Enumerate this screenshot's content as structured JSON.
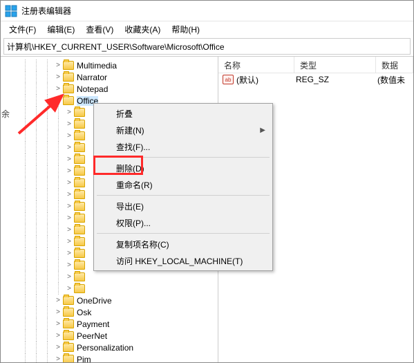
{
  "window": {
    "title": "注册表编辑器"
  },
  "menu": {
    "file": "文件(F)",
    "edit": "编辑(E)",
    "view": "查看(V)",
    "favorites": "收藏夹(A)",
    "help": "帮助(H)"
  },
  "address": {
    "path": "计算机\\HKEY_CURRENT_USER\\Software\\Microsoft\\Office"
  },
  "list": {
    "headers": {
      "name": "名称",
      "type": "类型",
      "data": "数据"
    },
    "rows": [
      {
        "icon": "ab",
        "name": "(默认)",
        "type": "REG_SZ",
        "data": "(数值未"
      }
    ]
  },
  "tree": {
    "items": [
      {
        "indent": 88,
        "expander": ">",
        "label": "Multimedia"
      },
      {
        "indent": 88,
        "expander": ">",
        "label": "Narrator"
      },
      {
        "indent": 88,
        "expander": ">",
        "label": "Notepad"
      },
      {
        "indent": 88,
        "expander": "v",
        "label": "Office",
        "selected": true
      },
      {
        "indent": 104,
        "expander": ">",
        "label": ""
      },
      {
        "indent": 104,
        "expander": ">",
        "label": ""
      },
      {
        "indent": 104,
        "expander": ">",
        "label": ""
      },
      {
        "indent": 104,
        "expander": ">",
        "label": ""
      },
      {
        "indent": 104,
        "expander": ">",
        "label": ""
      },
      {
        "indent": 104,
        "expander": ">",
        "label": ""
      },
      {
        "indent": 104,
        "expander": ">",
        "label": ""
      },
      {
        "indent": 104,
        "expander": ">",
        "label": ""
      },
      {
        "indent": 104,
        "expander": ">",
        "label": ""
      },
      {
        "indent": 104,
        "expander": ">",
        "label": ""
      },
      {
        "indent": 104,
        "expander": ">",
        "label": ""
      },
      {
        "indent": 104,
        "expander": ">",
        "label": ""
      },
      {
        "indent": 104,
        "expander": ">",
        "label": ""
      },
      {
        "indent": 104,
        "expander": ">",
        "label": ""
      },
      {
        "indent": 104,
        "expander": ">",
        "label": ""
      },
      {
        "indent": 104,
        "expander": ">",
        "label": ""
      },
      {
        "indent": 88,
        "expander": ">",
        "label": "OneDrive"
      },
      {
        "indent": 88,
        "expander": ">",
        "label": "Osk"
      },
      {
        "indent": 88,
        "expander": ">",
        "label": "Payment"
      },
      {
        "indent": 88,
        "expander": ">",
        "label": "PeerNet"
      },
      {
        "indent": 88,
        "expander": ">",
        "label": "Personalization"
      },
      {
        "indent": 88,
        "expander": ">",
        "label": "Pim"
      }
    ]
  },
  "context_menu": {
    "collapse": "折叠",
    "new": "新建(N)",
    "find": "查找(F)...",
    "delete": "删除(D)",
    "rename": "重命名(R)",
    "export": "导出(E)",
    "permissions": "权限(P)...",
    "copy_key_name": "复制项名称(C)",
    "goto_hklm": "访问 HKEY_LOCAL_MACHINE(T)"
  },
  "side_label": "余"
}
